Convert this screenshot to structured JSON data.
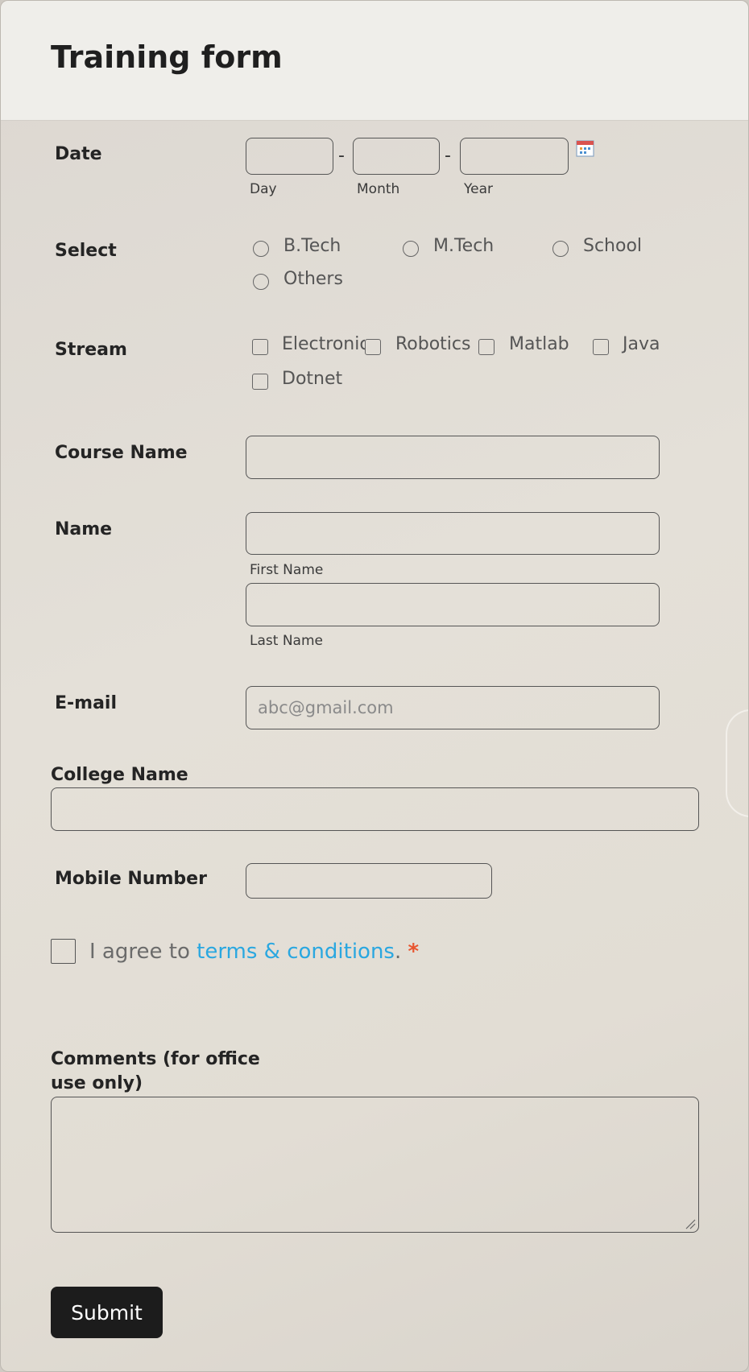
{
  "form": {
    "title": "Training form",
    "date": {
      "label": "Date",
      "separator": "-",
      "day_label": "Day",
      "month_label": "Month",
      "year_label": "Year",
      "icon": "calendar-icon"
    },
    "select": {
      "label": "Select",
      "options": [
        "B.Tech",
        "M.Tech",
        "School",
        "Others"
      ]
    },
    "stream": {
      "label": "Stream",
      "options": [
        "Electronic",
        "Robotics",
        "Matlab",
        "Java",
        "Dotnet"
      ]
    },
    "course_name": {
      "label": "Course Name"
    },
    "name": {
      "label": "Name",
      "first_label": "First Name",
      "last_label": "Last Name"
    },
    "email": {
      "label": "E-mail",
      "placeholder": "abc@gmail.com"
    },
    "college_name": {
      "label": "College Name"
    },
    "mobile": {
      "label": "Mobile Number"
    },
    "agree": {
      "prefix": "I agree to ",
      "link": "terms & conditions",
      "suffix": ".",
      "required_mark": "*"
    },
    "comments": {
      "label_line1": "Comments (for office",
      "label_line2": "use only)"
    },
    "submit_label": "Submit"
  },
  "colors": {
    "link": "#2aa7e0",
    "required": "#e8552f",
    "button": "#1c1c1c"
  }
}
